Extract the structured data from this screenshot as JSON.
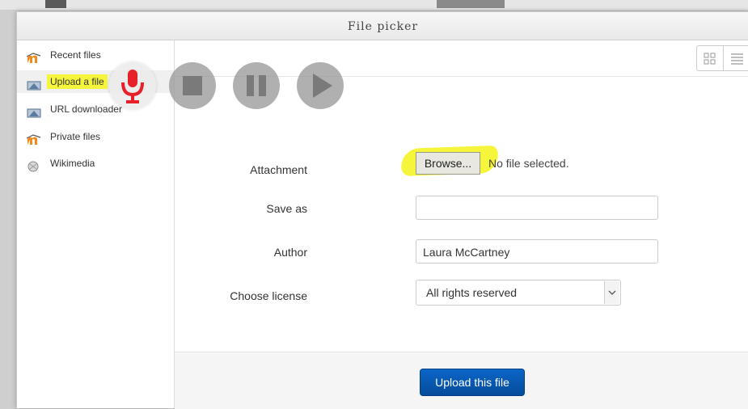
{
  "dialog": {
    "title": "File picker"
  },
  "sidebar": {
    "items": [
      {
        "label": "Recent files",
        "icon": "moodle-icon"
      },
      {
        "label": "Upload a file",
        "icon": "upload-icon"
      },
      {
        "label": "URL downloader",
        "icon": "url-icon"
      },
      {
        "label": "Private files",
        "icon": "moodle-icon"
      },
      {
        "label": "Wikimedia",
        "icon": "wikimedia-icon"
      }
    ]
  },
  "recorder": {
    "controls": [
      "microphone-icon",
      "stop-icon",
      "pause-icon",
      "play-icon"
    ]
  },
  "form": {
    "attachment_label": "Attachment",
    "browse_label": "Browse...",
    "file_status": "No file selected.",
    "save_as_label": "Save as",
    "save_as_value": "",
    "author_label": "Author",
    "author_value": "Laura McCartney",
    "license_label": "Choose license",
    "license_value": "All rights reserved"
  },
  "footer": {
    "upload_label": "Upload this file"
  },
  "colors": {
    "highlight": "#f5f53b",
    "primary_button": "#0a5bb5",
    "mic_red": "#e8202a",
    "control_gray": "#969696"
  }
}
